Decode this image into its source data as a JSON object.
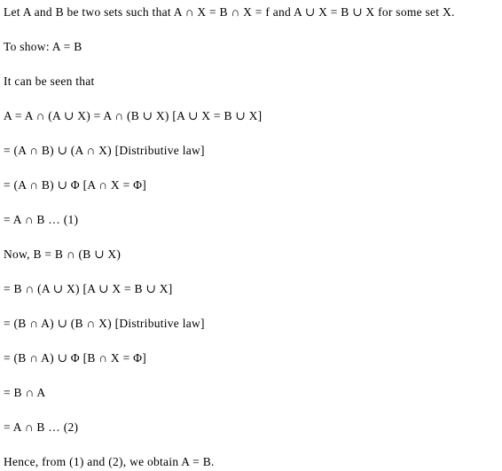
{
  "document": {
    "background_color": "#ffffff",
    "text_color": "#000000",
    "lines": [
      {
        "id": "premise",
        "text": "Let A and B be two sets such that A ∩ X = B ∩ X = f and A ∪ X = B ∪ X for some set X."
      },
      {
        "id": "to-show",
        "text": "To show: A = B"
      },
      {
        "id": "observation",
        "text": "It can be seen that"
      },
      {
        "id": "step-a-1",
        "text": "A = A ∩ (A ∪ X) = A ∩ (B ∪ X) [A ∪ X = B ∪ X]"
      },
      {
        "id": "step-a-2",
        "text": "= (A ∩ B) ∪ (A ∩ X) [Distributive law]"
      },
      {
        "id": "step-a-3",
        "text": "= (A ∩ B) ∪ Φ [A ∩ X = Φ]"
      },
      {
        "id": "step-a-4",
        "text": "= A ∩ B … (1)"
      },
      {
        "id": "step-b-1",
        "text": "Now, B = B ∩ (B ∪ X)"
      },
      {
        "id": "step-b-2",
        "text": "= B ∩ (A ∪ X) [A ∪ X = B ∪ X]"
      },
      {
        "id": "step-b-3",
        "text": "= (B ∩ A) ∪ (B ∩ X) [Distributive law]"
      },
      {
        "id": "step-b-4",
        "text": "= (B ∩ A) ∪ Φ [B ∩ X = Φ]"
      },
      {
        "id": "step-b-5",
        "text": "= B ∩ A"
      },
      {
        "id": "step-b-6",
        "text": "= A ∩ B … (2)"
      },
      {
        "id": "conclusion",
        "text": "Hence, from (1) and (2), we obtain A = B."
      }
    ]
  }
}
